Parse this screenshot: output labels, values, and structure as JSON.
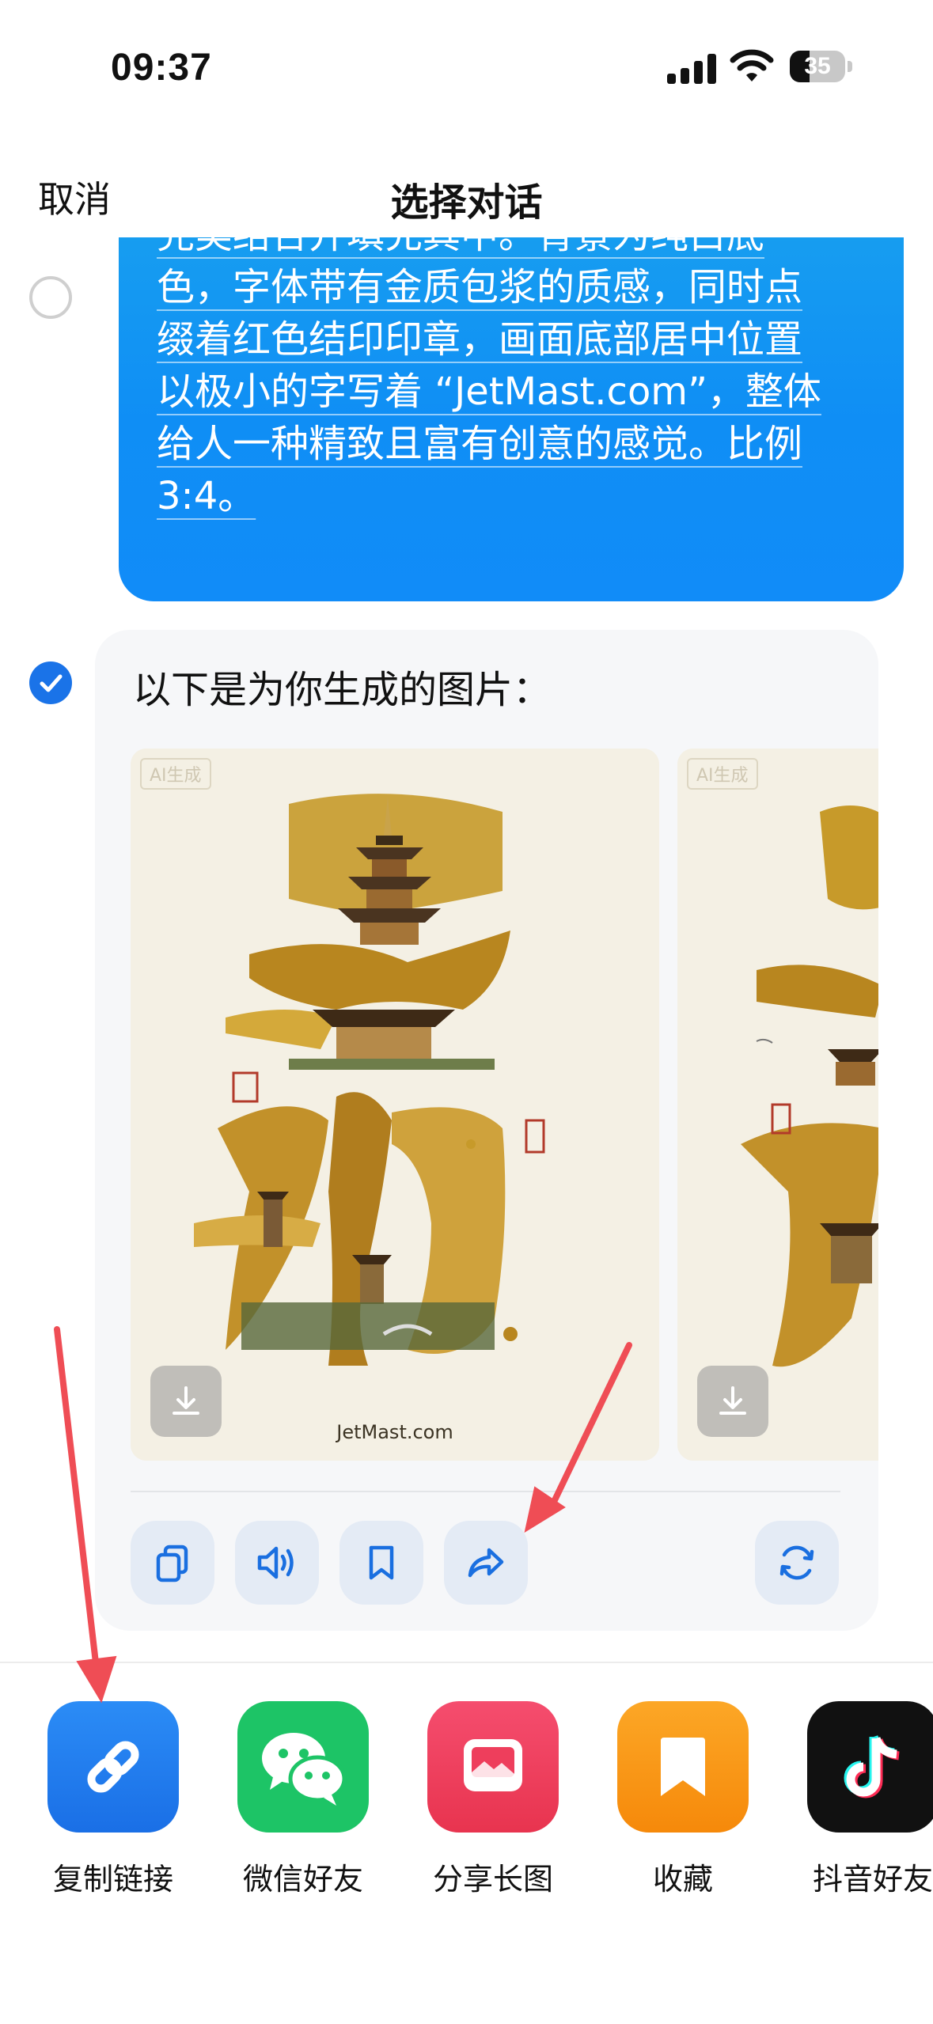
{
  "status_bar": {
    "time": "09:37",
    "battery_level": "35",
    "battery_fraction": 0.35
  },
  "nav": {
    "cancel_label": "取消",
    "title": "选择对话"
  },
  "user_message": {
    "lines": [
      "完美结合并填充其中。背景为纯白底",
      "色，字体带有金质包浆的质感，同时点",
      "缀着红色结印印章，画面底部居中位置",
      "以极小的字写着 “JetMast.com”，整体",
      "给人一种精致且富有创意的感觉。比例",
      "3:4。"
    ],
    "selected": false,
    "bubble_color": "#128ff5"
  },
  "ai_message": {
    "heading": "以下是为你生成的图片：",
    "selected": true,
    "images": [
      {
        "badge": "AI生成",
        "caption": "JetMast.com",
        "icon": "download-icon"
      },
      {
        "badge": "AI生成",
        "caption": "",
        "icon": "download-icon"
      }
    ],
    "actions": [
      {
        "name": "copy",
        "icon": "copy-icon"
      },
      {
        "name": "speak",
        "icon": "speaker-icon"
      },
      {
        "name": "bookmark",
        "icon": "bookmark-icon"
      },
      {
        "name": "share",
        "icon": "share-arrow-icon"
      },
      {
        "name": "regenerate",
        "icon": "refresh-icon"
      }
    ]
  },
  "share_sheet": {
    "items": [
      {
        "label": "复制链接",
        "icon": "link-icon",
        "color": "#1f7ff0"
      },
      {
        "label": "微信好友",
        "icon": "wechat-icon",
        "color": "#1dc466"
      },
      {
        "label": "分享长图",
        "icon": "image-icon",
        "color": "#ef3e5f"
      },
      {
        "label": "收藏",
        "icon": "bookmark-icon",
        "color": "#f99411"
      },
      {
        "label": "抖音好友",
        "icon": "douyin-icon",
        "color": "#111111"
      }
    ]
  },
  "colors": {
    "accent": "#1a73e8",
    "annotation_arrow": "#ef4d55"
  }
}
